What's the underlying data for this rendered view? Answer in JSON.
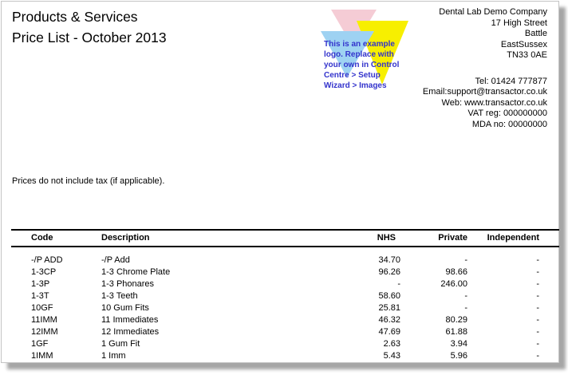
{
  "report": {
    "title_line1": "Products & Services",
    "title_line2": "Price List - October 2013",
    "tax_note": "Prices do not include tax (if applicable)."
  },
  "logo": {
    "text_lines": [
      "This is an example",
      "logo. Replace with",
      "your own in Control",
      "Centre > Setup",
      "Wizard > Images"
    ],
    "colors": {
      "pink": "#f5ccd5",
      "yellow": "#f7ef00",
      "blue": "#9ed2f2",
      "text": "#3333cc"
    }
  },
  "company": {
    "address_lines": [
      "Dental Lab Demo Company",
      "17 High Street",
      "Battle",
      "EastSussex",
      "TN33 0AE"
    ],
    "contact_lines": [
      "Tel: 01424 777877",
      "Email:support@transactor.co.uk",
      "Web: www.transactor.co.uk",
      "VAT reg: 000000000",
      "MDA no: 00000000"
    ]
  },
  "table": {
    "headers": [
      "Code",
      "Description",
      "NHS",
      "Private",
      "Independent"
    ],
    "rows": [
      [
        "-/P ADD",
        "-/P Add",
        "34.70",
        "-",
        "-"
      ],
      [
        "1-3CP",
        "1-3 Chrome Plate",
        "96.26",
        "98.66",
        "-"
      ],
      [
        "1-3P",
        "1-3 Phonares",
        "-",
        "246.00",
        "-"
      ],
      [
        "1-3T",
        "1-3 Teeth",
        "58.60",
        "-",
        "-"
      ],
      [
        "10GF",
        "10 Gum Fits",
        "25.81",
        "-",
        "-"
      ],
      [
        "11IMM",
        "11 Immediates",
        "46.32",
        "80.29",
        "-"
      ],
      [
        "12IMM",
        "12 Immediates",
        "47.69",
        "61.88",
        "-"
      ],
      [
        "1GF",
        "1 Gum Fit",
        "2.63",
        "3.94",
        "-"
      ],
      [
        "1IMM",
        "1 Imm",
        "5.43",
        "5.96",
        "-"
      ]
    ]
  }
}
